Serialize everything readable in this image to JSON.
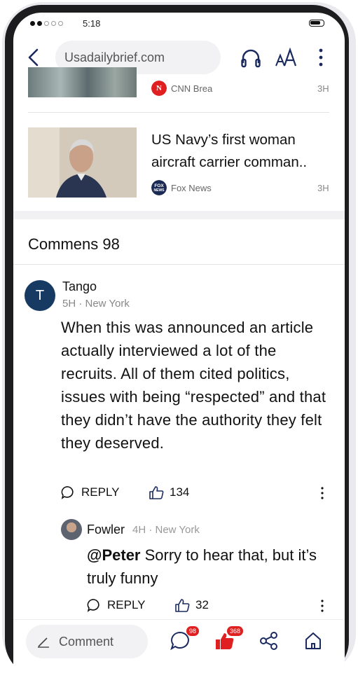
{
  "status_bar": {
    "time": "5:18"
  },
  "top_bar": {
    "url": "Usadailybrief.com"
  },
  "news": [
    {
      "source": "CNN Brea",
      "age": "3H"
    },
    {
      "headline": "US Navy’s first woman aircraft carrier  comman..",
      "source": "Fox News",
      "age": "3H"
    }
  ],
  "comments_header": "Commens 98",
  "comment": {
    "avatar_letter": "T",
    "author": "Tango",
    "meta": "5H · New York",
    "text": "When this was announced an article actually interviewed a lot of the recruits. All of them cited politics, issues with being “respected” and that they didn’t have the authority they felt they deserved.",
    "reply_label": "REPLY",
    "likes": "134"
  },
  "reply": {
    "author": "Fowler",
    "meta": "4H · New York",
    "mention": "@Peter",
    "text": " Sorry to hear that, but it’s truly funny",
    "reply_label": "REPLY",
    "likes": "32"
  },
  "bottom_bar": {
    "comment_placeholder": "Comment",
    "comment_badge": "98",
    "like_badge": "368"
  },
  "colors": {
    "accent": "#173a63",
    "like_red": "#e02020",
    "icon_navy": "#1a2a5e"
  }
}
